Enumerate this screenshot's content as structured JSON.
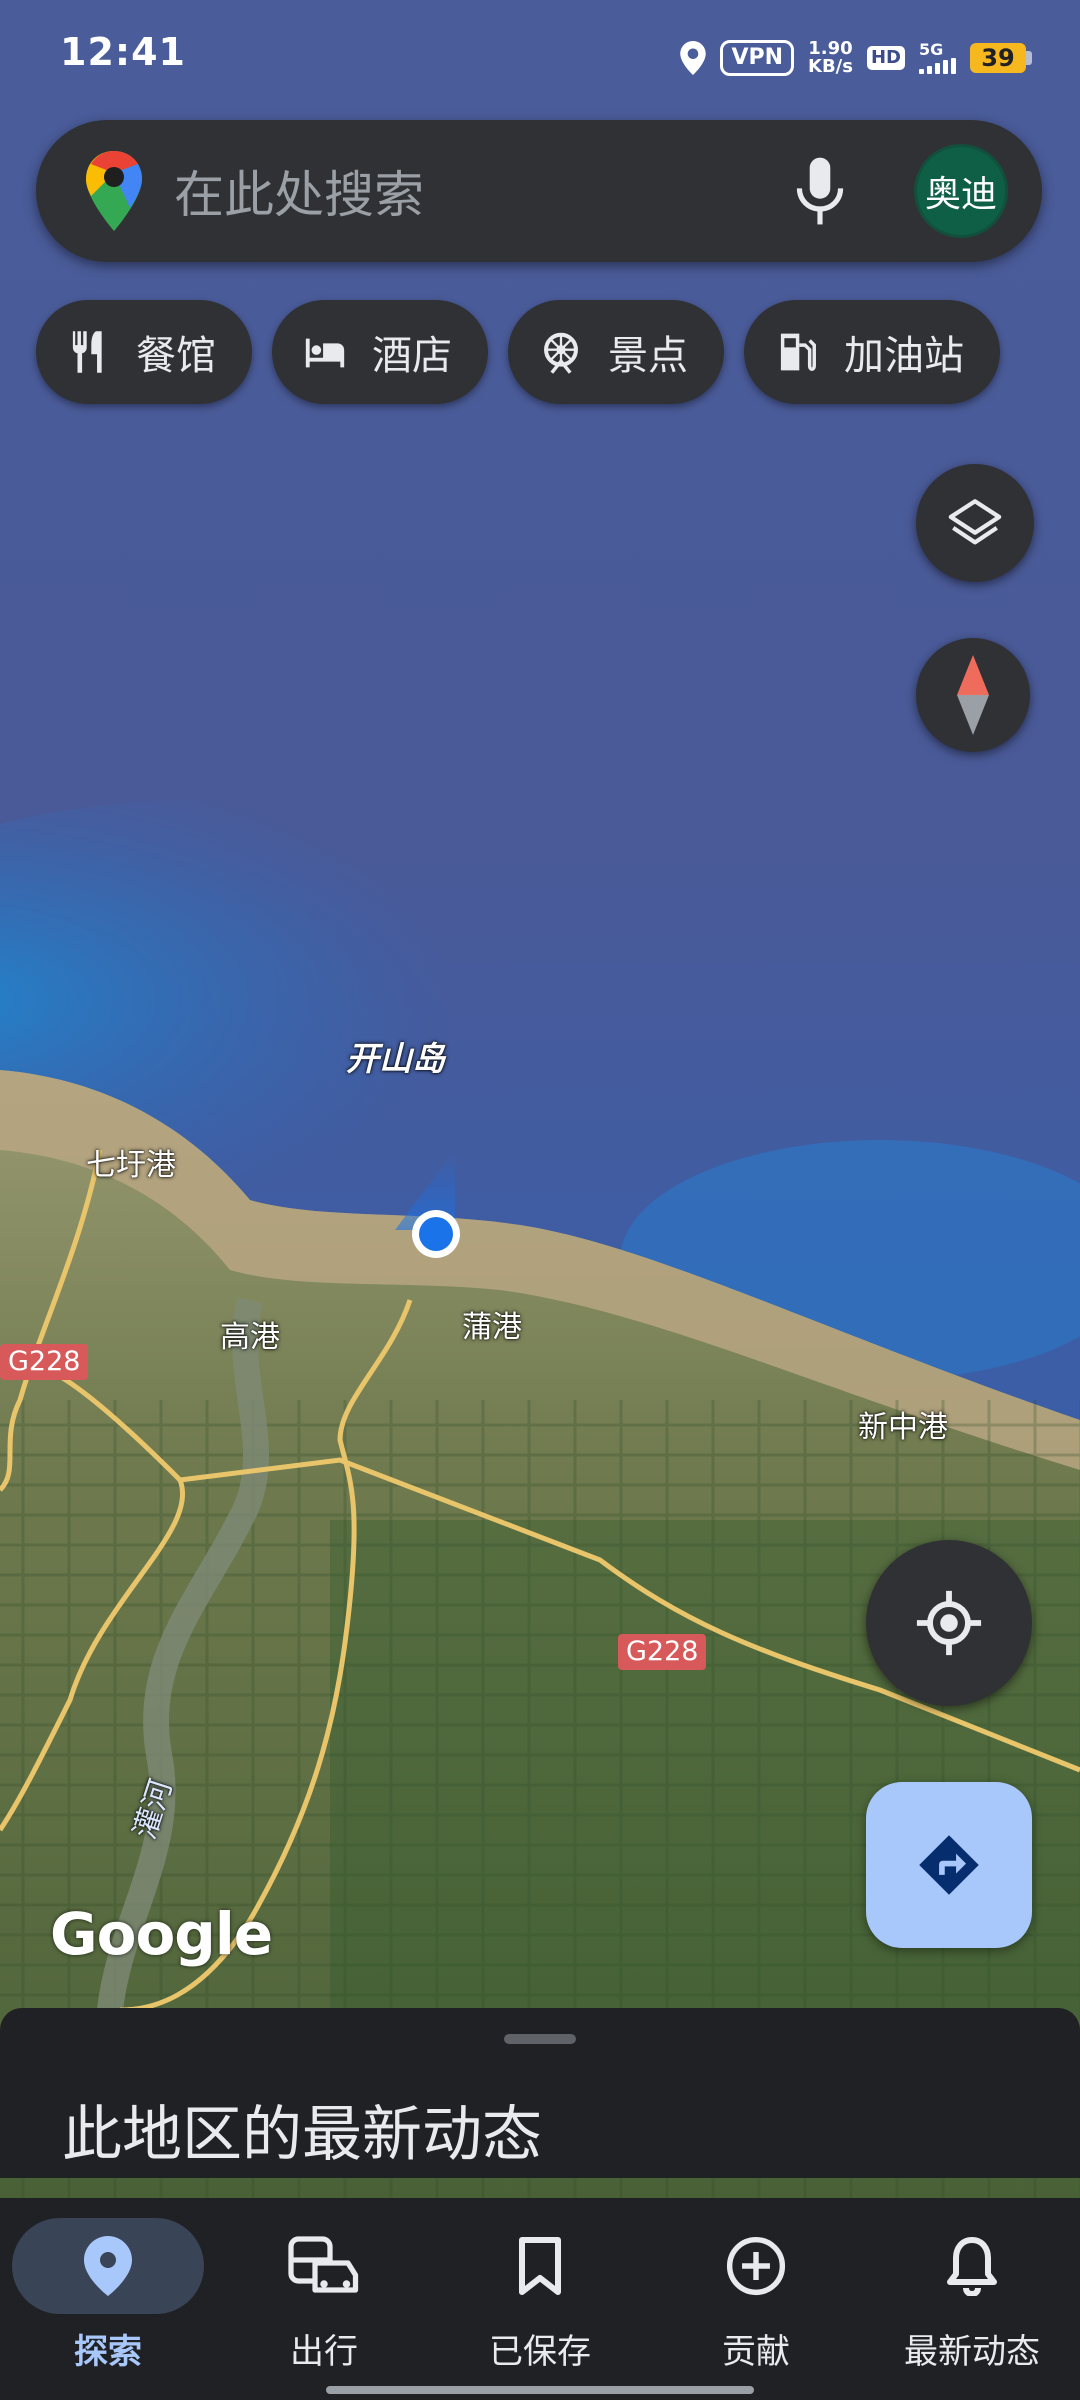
{
  "status_bar": {
    "time": "12:41",
    "location_icon": "location-pin-icon",
    "vpn": "VPN",
    "net_speed_value": "1.90",
    "net_speed_unit": "KB/s",
    "hd": "HD",
    "network": "5G",
    "battery": "39",
    "battery_color": "#f6b81e"
  },
  "search": {
    "placeholder": "在此处搜索",
    "avatar_text": "奥迪",
    "logo_icon": "google-maps-pin-icon",
    "mic_icon": "microphone-icon"
  },
  "chips": [
    {
      "label": "餐馆",
      "icon": "restaurant-icon"
    },
    {
      "label": "酒店",
      "icon": "hotel-bed-icon"
    },
    {
      "label": "景点",
      "icon": "attraction-icon"
    },
    {
      "label": "加油站",
      "icon": "gas-station-icon"
    }
  ],
  "map": {
    "type": "satellite",
    "place_labels": [
      "开山岛",
      "七圩港",
      "高港",
      "蒲港",
      "新中港",
      "灌河"
    ],
    "road_shields": [
      "G228",
      "G228"
    ],
    "watermark": "Google",
    "road_shield_color": "#d8595a",
    "my_location_color": "#1a73e8"
  },
  "controls": {
    "layers_icon": "layers-icon",
    "compass_icon": "compass-icon",
    "locate_icon": "my-location-icon",
    "directions_icon": "directions-icon",
    "directions_color": "#a8c7fa"
  },
  "bottom_sheet": {
    "title": "此地区的最新动态"
  },
  "nav": {
    "items": [
      {
        "label": "探索",
        "icon": "explore-pin-icon",
        "active": true
      },
      {
        "label": "出行",
        "icon": "commute-icon",
        "active": false
      },
      {
        "label": "已保存",
        "icon": "bookmark-icon",
        "active": false
      },
      {
        "label": "贡献",
        "icon": "add-circle-icon",
        "active": false
      },
      {
        "label": "最新动态",
        "icon": "bell-icon",
        "active": false
      }
    ],
    "accent": "#a8c7fa"
  }
}
